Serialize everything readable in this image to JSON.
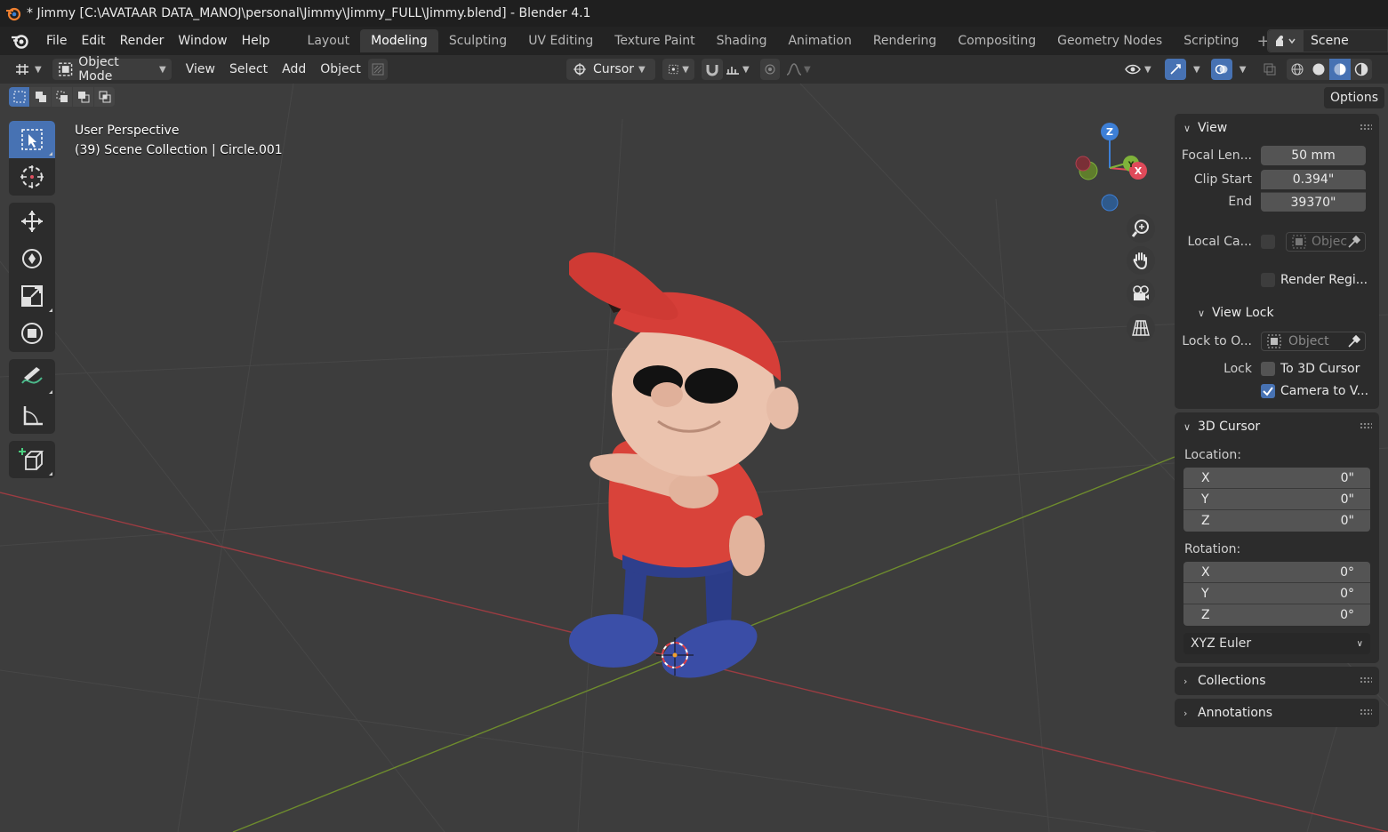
{
  "titlebar": {
    "title": "* Jimmy [C:\\AVATAAR DATA_MANOJ\\personal\\Jimmy\\Jimmy_FULL\\Jimmy.blend] - Blender 4.1"
  },
  "menubar": {
    "menus": [
      "File",
      "Edit",
      "Render",
      "Window",
      "Help"
    ],
    "workspaces": [
      "Layout",
      "Modeling",
      "Sculpting",
      "UV Editing",
      "Texture Paint",
      "Shading",
      "Animation",
      "Rendering",
      "Compositing",
      "Geometry Nodes",
      "Scripting"
    ],
    "active_workspace": "Modeling",
    "scene": "Scene"
  },
  "header": {
    "mode": "Object Mode",
    "menus": [
      "View",
      "Select",
      "Add",
      "Object"
    ],
    "pivot": "Cursor"
  },
  "viewport": {
    "options_label": "Options",
    "perspective": "User Perspective",
    "collection": "(39) Scene Collection | Circle.001",
    "gizmo": {
      "z": "Z",
      "x": "X",
      "y": "Y"
    }
  },
  "npanel": {
    "view": {
      "title": "View",
      "focal_label": "Focal Len...",
      "focal_value": "50 mm",
      "clip_start_label": "Clip Start",
      "clip_start_value": "0.394\"",
      "clip_end_label": "End",
      "clip_end_value": "39370\"",
      "local_camera_label": "Local Ca...",
      "local_camera_placeholder": "Objec",
      "render_region_label": "Render Regi..."
    },
    "view_lock": {
      "title": "View Lock",
      "lock_object_label": "Lock to O...",
      "lock_object_placeholder": "Object",
      "lock_label": "Lock",
      "to_cursor_label": "To 3D Cursor",
      "camera_to_view_label": "Camera to V..."
    },
    "cursor": {
      "title": "3D Cursor",
      "location_label": "Location:",
      "location": [
        {
          "axis": "X",
          "value": "0\""
        },
        {
          "axis": "Y",
          "value": "0\""
        },
        {
          "axis": "Z",
          "value": "0\""
        }
      ],
      "rotation_label": "Rotation:",
      "rotation": [
        {
          "axis": "X",
          "value": "0°"
        },
        {
          "axis": "Y",
          "value": "0°"
        },
        {
          "axis": "Z",
          "value": "0°"
        }
      ],
      "rotation_mode": "XYZ Euler"
    },
    "collections_title": "Collections",
    "annotations_title": "Annotations"
  },
  "colors": {
    "accent": "#4772b3",
    "x_axis": "#e04a5a",
    "y_axis": "#7fb23a",
    "z_axis": "#3d7fd6"
  }
}
